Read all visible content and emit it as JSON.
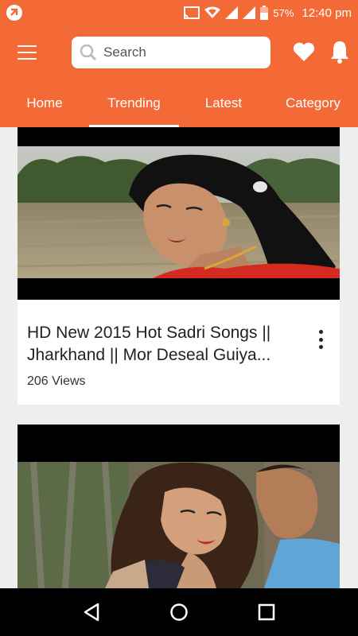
{
  "status_bar": {
    "battery": "57%",
    "time": "12:40 pm"
  },
  "app_bar": {
    "search_placeholder": "Search"
  },
  "tabs": [
    {
      "label": "Home",
      "active": false
    },
    {
      "label": "Trending",
      "active": true
    },
    {
      "label": "Latest",
      "active": false
    },
    {
      "label": "Category",
      "active": false
    }
  ],
  "videos": [
    {
      "title": "HD New 2015 Hot Sadri Songs || Jharkhand || Mor Deseal Guiya...",
      "views": "206 Views"
    },
    {
      "title": "",
      "views": ""
    }
  ],
  "colors": {
    "accent": "#f46a37",
    "background": "#eeeeee",
    "navbar": "#000000"
  },
  "icons": [
    "notification-app-icon",
    "cast-icon",
    "wifi-icon",
    "signal-icon",
    "battery-icon",
    "menu-icon",
    "search-icon",
    "heart-icon",
    "bell-icon",
    "more-vert-icon",
    "back-icon",
    "home-icon",
    "recents-icon"
  ]
}
